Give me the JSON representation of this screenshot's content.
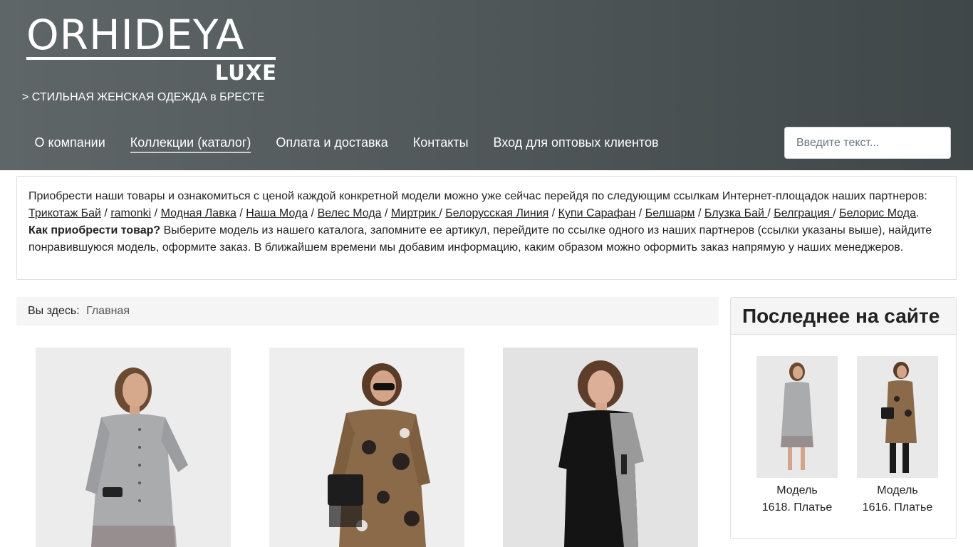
{
  "header": {
    "logo_main": "ORHIDEYA",
    "logo_sub": "LUXE",
    "tagline": "> СТИЛЬНАЯ ЖЕНСКАЯ ОДЕЖДА в БРЕСТЕ"
  },
  "nav": {
    "items": [
      {
        "label": "О компании"
      },
      {
        "label": "Коллекции (каталог)"
      },
      {
        "label": "Оплата и доставка"
      },
      {
        "label": "Контакты"
      },
      {
        "label": "Вход для оптовых клиентов"
      }
    ],
    "active_index": 1
  },
  "search": {
    "placeholder": "Введите текст..."
  },
  "info": {
    "intro": "Приобрести наши товары и ознакомиться с ценой каждой конкретной модели можно уже сейчас перейдя по следующим ссылкам Интернет-площадок наших партнеров:",
    "partners": [
      "Трикотаж Бай",
      "ramonki",
      "Модная Лавка",
      "Наша Мода",
      "Велес Мода",
      "Миртрик ",
      "Белорусская Линия",
      "Купи Сарафан",
      "Белшарм",
      "Блузка Бай ",
      "Белграция ",
      "Белорис Мода"
    ],
    "how_title": "Как приобрести товар?",
    "how_text": " Выберите модель из нашего каталога, запомните ее артикул, перейдите по ссылке одного из наших партнеров (ссылки указаны выше), найдите понравившуюся модель, оформите заказ. В ближайшем времени мы добавим информацию, каким образом можно оформить заказ напрямую у наших менеджеров."
  },
  "breadcrumb": {
    "label": "Вы здесь:",
    "current": "Главная"
  },
  "sidebar": {
    "title": "Последнее на сайте",
    "items": [
      {
        "caption_line1": "Модель",
        "caption_line2": "1618. Платье"
      },
      {
        "caption_line1": "Модель",
        "caption_line2": "1616. Платье"
      }
    ]
  },
  "colors": {
    "header_bg": "#4f5759",
    "text": "#222222",
    "border": "#dfdfdf",
    "panel_bg": "#f5f5f5"
  }
}
